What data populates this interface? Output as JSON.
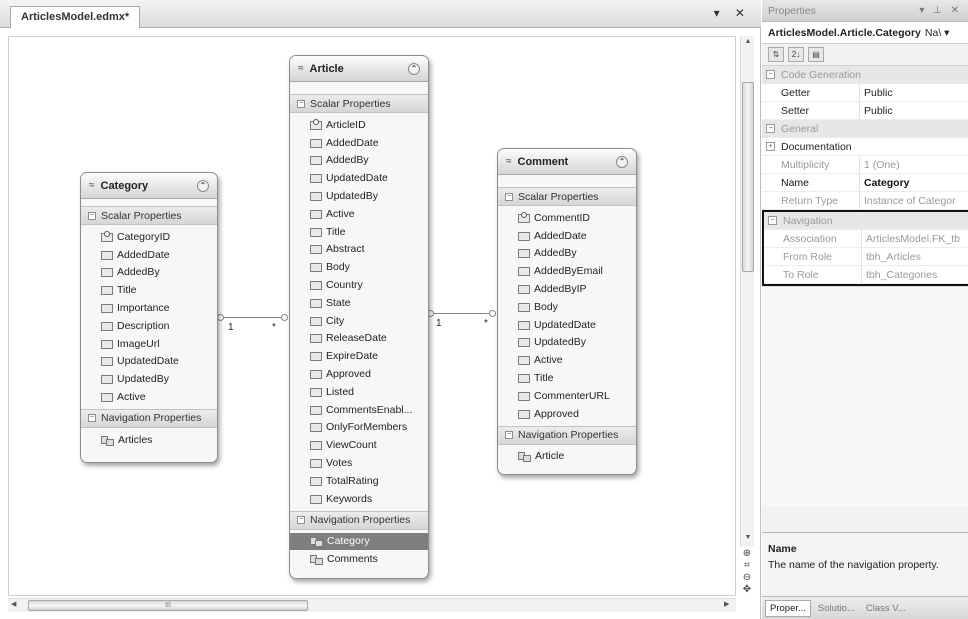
{
  "document_tab": {
    "title": "ArticlesModel.edmx*",
    "controls": "▾ ✕"
  },
  "entities": {
    "category": {
      "name": "Category",
      "scalar_header": "Scalar Properties",
      "properties": [
        "CategoryID",
        "AddedDate",
        "AddedBy",
        "Title",
        "Importance",
        "Description",
        "ImageUrl",
        "UpdatedDate",
        "UpdatedBy",
        "Active"
      ],
      "nav_header": "Navigation Properties",
      "navigation": [
        "Articles"
      ]
    },
    "article": {
      "name": "Article",
      "scalar_header": "Scalar Properties",
      "properties": [
        "ArticleID",
        "AddedDate",
        "AddedBy",
        "UpdatedDate",
        "UpdatedBy",
        "Active",
        "Title",
        "Abstract",
        "Body",
        "Country",
        "State",
        "City",
        "ReleaseDate",
        "ExpireDate",
        "Approved",
        "Listed",
        "CommentsEnabl...",
        "OnlyForMembers",
        "ViewCount",
        "Votes",
        "TotalRating",
        "Keywords"
      ],
      "nav_header": "Navigation Properties",
      "navigation": [
        "Category",
        "Comments"
      ],
      "selected_navigation": "Category"
    },
    "comment": {
      "name": "Comment",
      "scalar_header": "Scalar Properties",
      "properties": [
        "CommentID",
        "AddedDate",
        "AddedBy",
        "AddedByEmail",
        "AddedByIP",
        "Body",
        "UpdatedDate",
        "UpdatedBy",
        "Active",
        "Title",
        "CommenterURL",
        "Approved"
      ],
      "nav_header": "Navigation Properties",
      "navigation": [
        "Article"
      ]
    }
  },
  "associations": [
    {
      "left_mult": "1",
      "right_mult": "*"
    },
    {
      "left_mult": "1",
      "right_mult": "*"
    }
  ],
  "properties_panel": {
    "title": "Properties",
    "title_controls": "▾ ⊥ ✕",
    "object_name": "ArticlesModel.Article.Category",
    "object_type": "Na\\ ▾",
    "toolbar": [
      "⇅",
      "2↓",
      "▤"
    ],
    "categories": {
      "code_generation": "Code Generation",
      "general": "General",
      "documentation": "Documentation",
      "navigation": "Navigation"
    },
    "rows": {
      "getter": {
        "key": "Getter",
        "value": "Public"
      },
      "setter": {
        "key": "Setter",
        "value": "Public"
      },
      "multiplicity": {
        "key": "Multiplicity",
        "value": "1 (One)"
      },
      "name": {
        "key": "Name",
        "value": "Category"
      },
      "return_type": {
        "key": "Return Type",
        "value": "Instance of Categor"
      },
      "association": {
        "key": "Association",
        "value": "ArticlesModel.FK_tb"
      },
      "from_role": {
        "key": "From Role",
        "value": "tbh_Articles"
      },
      "to_role": {
        "key": "To Role",
        "value": "tbh_Categories"
      }
    },
    "description": {
      "title": "Name",
      "text": "The name of the navigation property."
    },
    "tabs": [
      "Proper...",
      "Solutio...",
      "Class V..."
    ]
  },
  "scrollbar": {
    "hthumb_label": "III"
  }
}
